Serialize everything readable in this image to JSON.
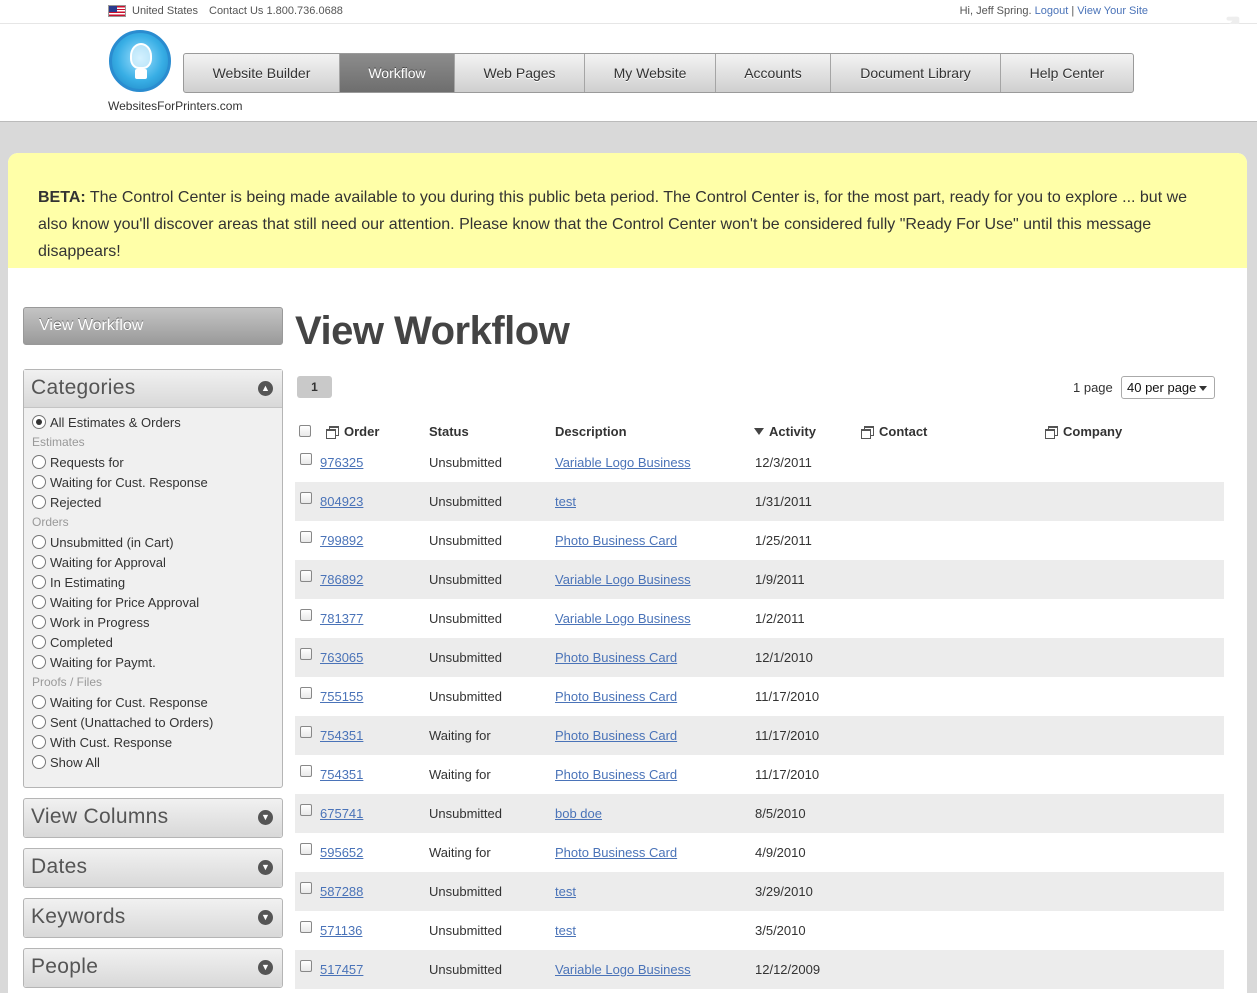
{
  "topbar": {
    "country": "United States",
    "contact": "Contact Us  1.800.736.0688",
    "greeting": "Hi, Jeff Spring.",
    "logout": "Logout",
    "separator": "|",
    "view_site": "View Your Site"
  },
  "header": {
    "site_name": "WebsitesForPrinters.com",
    "nav": [
      {
        "label": "Website Builder",
        "active": false
      },
      {
        "label": "Workflow",
        "active": true
      },
      {
        "label": "Web Pages",
        "active": false
      },
      {
        "label": "My Website",
        "active": false
      },
      {
        "label": "Accounts",
        "active": false
      },
      {
        "label": "Document Library",
        "active": false
      },
      {
        "label": "Help Center",
        "active": false
      }
    ]
  },
  "beta": {
    "label": "BETA:",
    "text": "The Control Center is being made available to you during this public beta period. The Control Center is, for the most part, ready for you to explore ... but we also know you'll discover areas that still need our attention. Please know that the Control Center won't be considered fully \"Ready For Use\" until this message disappears!"
  },
  "sidebar": {
    "view_button": "View Workflow",
    "categories_title": "Categories",
    "categories": [
      {
        "type": "item",
        "label": "All Estimates & Orders",
        "selected": true
      },
      {
        "type": "group",
        "label": "Estimates"
      },
      {
        "type": "item",
        "label": "Requests for",
        "selected": false
      },
      {
        "type": "item",
        "label": "Waiting for Cust. Response",
        "selected": false
      },
      {
        "type": "item",
        "label": "Rejected",
        "selected": false
      },
      {
        "type": "group",
        "label": "Orders"
      },
      {
        "type": "item",
        "label": "Unsubmitted (in Cart)",
        "selected": false
      },
      {
        "type": "item",
        "label": "Waiting for Approval",
        "selected": false
      },
      {
        "type": "item",
        "label": "In Estimating",
        "selected": false
      },
      {
        "type": "item",
        "label": "Waiting for Price Approval",
        "selected": false
      },
      {
        "type": "item",
        "label": "Work in Progress",
        "selected": false
      },
      {
        "type": "item",
        "label": "Completed",
        "selected": false
      },
      {
        "type": "item",
        "label": "Waiting for Paymt.",
        "selected": false
      },
      {
        "type": "group",
        "label": "Proofs / Files"
      },
      {
        "type": "item",
        "label": "Waiting for Cust. Response",
        "selected": false
      },
      {
        "type": "item",
        "label": "Sent (Unattached to Orders)",
        "selected": false
      },
      {
        "type": "item",
        "label": "With Cust. Response",
        "selected": false
      },
      {
        "type": "item",
        "label": "Show All",
        "selected": false
      }
    ],
    "panels": [
      "View Columns",
      "Dates",
      "Keywords",
      "People"
    ]
  },
  "main": {
    "title": "View Workflow",
    "pager_current": "1",
    "page_count": "1 page",
    "per_page": "40 per page",
    "columns": {
      "order": "Order",
      "status": "Status",
      "description": "Description",
      "activity": "Activity",
      "contact": "Contact",
      "company": "Company"
    },
    "rows": [
      {
        "order": "976325",
        "status": "Unsubmitted",
        "description": "Variable Logo Business",
        "activity": "12/3/2011"
      },
      {
        "order": "804923",
        "status": "Unsubmitted",
        "description": "test",
        "activity": "1/31/2011"
      },
      {
        "order": "799892",
        "status": "Unsubmitted",
        "description": "Photo Business Card",
        "activity": "1/25/2011"
      },
      {
        "order": "786892",
        "status": "Unsubmitted",
        "description": "Variable Logo Business",
        "activity": "1/9/2011"
      },
      {
        "order": "781377",
        "status": "Unsubmitted",
        "description": "Variable Logo Business",
        "activity": "1/2/2011"
      },
      {
        "order": "763065",
        "status": "Unsubmitted",
        "description": "Photo Business Card",
        "activity": "12/1/2010"
      },
      {
        "order": "755155",
        "status": "Unsubmitted",
        "description": "Photo Business Card",
        "activity": "11/17/2010"
      },
      {
        "order": "754351",
        "status": "Waiting for",
        "description": "Photo Business Card",
        "activity": "11/17/2010"
      },
      {
        "order": "754351",
        "status": "Waiting for",
        "description": "Photo Business Card",
        "activity": "11/17/2010"
      },
      {
        "order": "675741",
        "status": "Unsubmitted",
        "description": "bob doe",
        "activity": "8/5/2010"
      },
      {
        "order": "595652",
        "status": "Waiting for",
        "description": "Photo Business Card",
        "activity": "4/9/2010"
      },
      {
        "order": "587288",
        "status": "Unsubmitted",
        "description": "test",
        "activity": "3/29/2010"
      },
      {
        "order": "571136",
        "status": "Unsubmitted",
        "description": "test",
        "activity": "3/5/2010"
      },
      {
        "order": "517457",
        "status": "Unsubmitted",
        "description": "Variable Logo Business",
        "activity": "12/12/2009"
      }
    ]
  },
  "colors": {
    "link": "#4a73b8",
    "beta_bg": "#ffffa8",
    "nav_active": "#7a7a7a"
  }
}
